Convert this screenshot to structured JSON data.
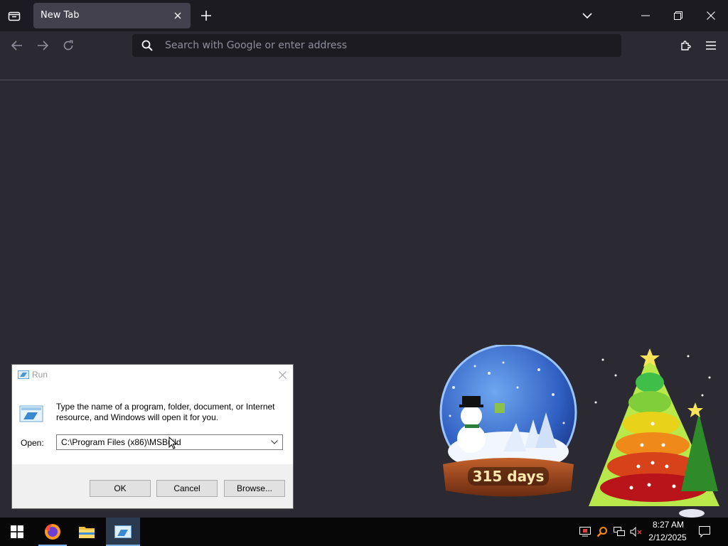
{
  "browser": {
    "tab_title": "New Tab",
    "url_placeholder": "Search with Google or enter address",
    "colors": {
      "chrome": "#2b2a33",
      "tab_active": "#42414d",
      "accent": "#fbfbfe"
    },
    "icons": [
      "firefox-view-icon",
      "close-icon",
      "plus-icon",
      "chevron-down-icon",
      "minimize-icon",
      "restore-icon",
      "back-icon",
      "forward-icon",
      "reload-icon",
      "search-icon",
      "extensions-icon",
      "menu-icon"
    ]
  },
  "run_dialog": {
    "title": "Run",
    "description": "Type the name of a program, folder, document, or Internet resource, and Windows will open it for you.",
    "open_label": "Open:",
    "open_value": "C:\\Program Files (x86)\\MSBuild",
    "buttons": {
      "ok": "OK",
      "cancel": "Cancel",
      "browse": "Browse..."
    }
  },
  "desktop_widget": {
    "countdown": "315 days"
  },
  "taskbar": {
    "pinned": [
      "windows-start-icon",
      "firefox-icon",
      "file-explorer-icon",
      "run-icon"
    ],
    "tray_icons": [
      "screen-icon",
      "search-tool-icon",
      "network-icon",
      "volume-muted-icon",
      "notification-icon"
    ],
    "time": "8:27 AM",
    "date": "2/12/2025"
  }
}
